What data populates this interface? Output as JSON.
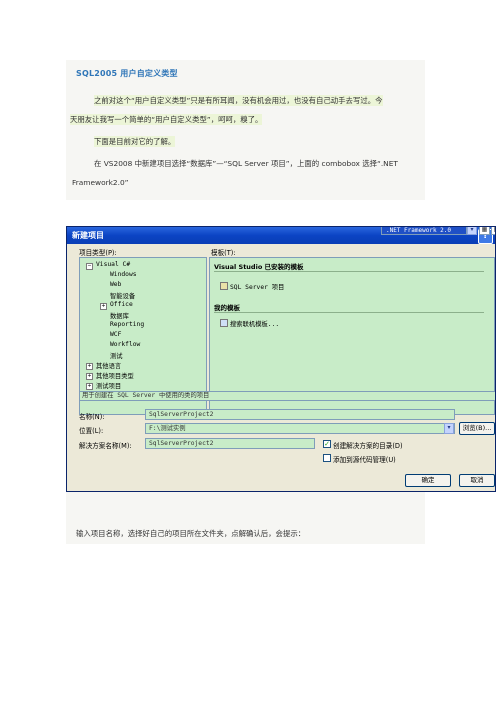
{
  "article": {
    "title": "SQL2005 用户自定义类型",
    "p1_line1": "之前对这个“用户自定义类型”只是有所耳闻，没有机会用过，也没有自己动手去写过。今",
    "p1_line2": "天朋友让我写一个简单的“用户自定义类型”，呵呵，糗了。",
    "p2": "下面是目前对它的了解。",
    "p3_line1": "在 VS2008 中新建项目选择“数据库”—“SQL Server 项目”，上面的 combobox 选择“.NET",
    "p3_line2": "Framework2.0”",
    "caption": "输入项目名称，选择好自己的项目所在文件夹，点解确认后，会提示："
  },
  "dialog": {
    "title": "新建项目",
    "help_label": "?",
    "project_types_label": "项目类型(P):",
    "templates_label": "模板(T):",
    "framework_combo": ".NET Framework 2.0",
    "tree": {
      "visual_csharp": "Visual C#",
      "children": [
        "Windows",
        "Web",
        "智能设备",
        "Office",
        "数据库",
        "Reporting",
        "WCF",
        "Workflow",
        "测试"
      ],
      "other_languages": "其他语言",
      "other_project_types": "其他项目类型",
      "test_project": "测试项目"
    },
    "installed_templates_heading": "Visual Studio 已安装的模板",
    "sql_server_template": "SQL Server 项目",
    "my_templates_heading": "我的模板",
    "search_online": "搜索联机模板...",
    "description": "用于创建在 SQL Server 中使用的类的项目",
    "name_label": "名称(N):",
    "name_value": "SqlServerProject2",
    "location_label": "位置(L):",
    "location_value": "F:\\测试实例",
    "solution_label": "解决方案名称(M):",
    "solution_value": "SqlServerProject2",
    "browse_button": "浏览(B)...",
    "create_dir_checkbox": "创建解决方案的目录(D)",
    "create_dir_checked": true,
    "add_source_control_checkbox": "添加到源代码管理(U)",
    "add_source_control_checked": false,
    "ok_button": "确定",
    "cancel_button": "取消"
  },
  "colors": {
    "title_blue": "#2f76b8",
    "highlight": "#ecf5d7",
    "dialog_panel": "#c8ecc8",
    "titlebar": "#0b44c4"
  }
}
